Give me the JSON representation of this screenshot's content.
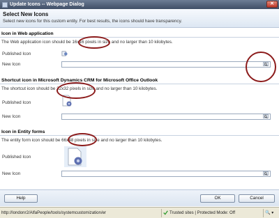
{
  "window": {
    "title": "Update Icons -- Webpage Dialog",
    "close_glyph": "✕"
  },
  "header": {
    "title": "Select New Icons",
    "description": "Select new icons for this custom entity. For best results, the icons should have transparency."
  },
  "sections": [
    {
      "heading": "Icon in Web application",
      "description_before": "The Web application icon should be ",
      "highlight": "16x16 pixels",
      "description_after": " in size and no larger than 10 kilobytes.",
      "published_label": "Published Icon",
      "new_label": "New Icon"
    },
    {
      "heading": "Shortcut icon in Microsoft Dynamics CRM for Microsoft Office Outlook",
      "description_before": "The shortcut icon should be ",
      "highlight": "32x32 pixels",
      "description_after": " in size and no larger than 10 kilobytes.",
      "published_label": "Published Icon",
      "new_label": "New Icon"
    },
    {
      "heading": "Icon in Entity forms",
      "description_before": "The entity form icon should be ",
      "highlight": "66x48 pixels",
      "description_after": " in size and no larger than 10 kilobytes.",
      "published_label": "Published Icon",
      "new_label": "New Icon"
    }
  ],
  "footer": {
    "help_label": "Help",
    "ok_label": "OK",
    "cancel_label": "Cancel"
  },
  "statusbar": {
    "url": "http://londonr2/AlfaPeople/tools/systemcustomization/er",
    "trusted": "Trusted sites | Protected Mode: Off",
    "zoom": "🔍 ▾"
  },
  "colors": {
    "annotation": "#8b1a1a",
    "title_bar": "#3f4e66"
  }
}
